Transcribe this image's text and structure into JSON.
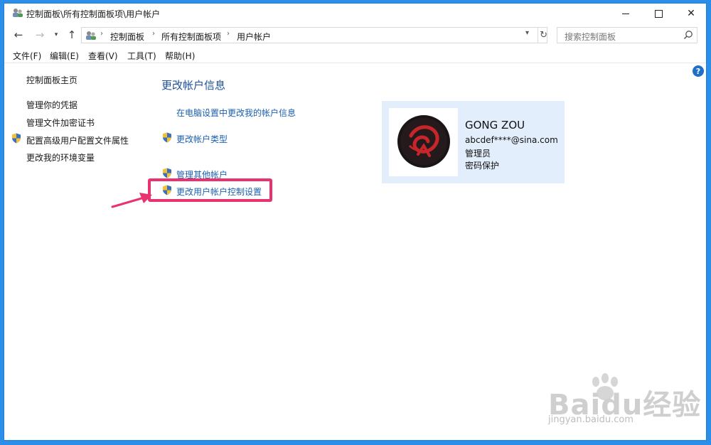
{
  "window": {
    "title": "控制面板\\所有控制面板项\\用户帐户"
  },
  "address": {
    "crumbs": [
      "控制面板",
      "所有控制面板项",
      "用户帐户"
    ]
  },
  "search": {
    "placeholder": "搜索控制面板"
  },
  "menu": [
    "文件(F)",
    "编辑(E)",
    "查看(V)",
    "工具(T)",
    "帮助(H)"
  ],
  "sidebar": {
    "items": [
      "控制面板主页",
      "管理你的凭据",
      "管理文件加密证书",
      "配置高级用户配置文件属性",
      "更改我的环境变量"
    ]
  },
  "main": {
    "heading": "更改帐户信息",
    "links": [
      "在电脑设置中更改我的帐户信息",
      "更改帐户类型",
      "管理其他帐户",
      "更改用户帐户控制设置"
    ]
  },
  "account": {
    "name": "GONG ZOU",
    "email": "abcdef****@sina.com",
    "role": "管理员",
    "status": "密码保护"
  },
  "watermark": {
    "brand": "Baidu经验",
    "url": "jingyan.baidu.com"
  },
  "colors": {
    "accent": "#1b5fb0",
    "highlight": "#e8336f",
    "card_bg": "#e2eefb"
  }
}
